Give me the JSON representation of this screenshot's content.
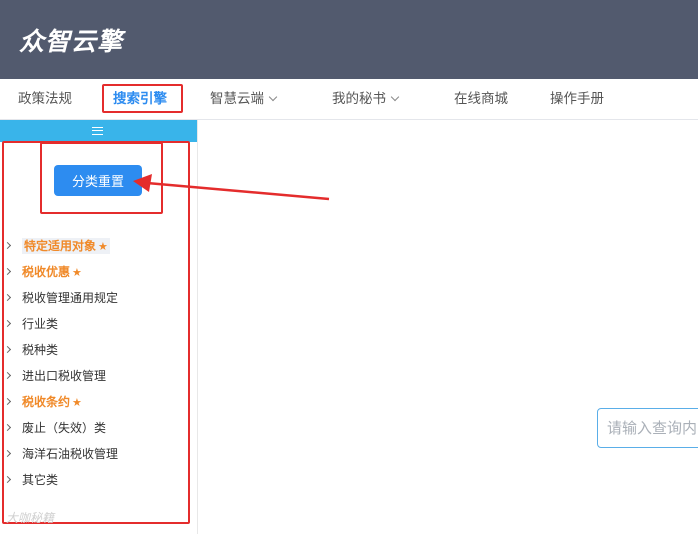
{
  "header": {
    "logo_text": "众智云擎",
    "background": "#525a6e"
  },
  "nav": {
    "items": [
      {
        "label": "政策法规",
        "has_dropdown": false,
        "active": false
      },
      {
        "label": "搜索引擎",
        "has_dropdown": false,
        "active": true
      },
      {
        "label": "智慧云端",
        "has_dropdown": true,
        "active": false
      },
      {
        "label": "我的秘书",
        "has_dropdown": true,
        "active": false
      },
      {
        "label": "在线商城",
        "has_dropdown": false,
        "active": false
      },
      {
        "label": "操作手册",
        "has_dropdown": false,
        "active": false
      }
    ]
  },
  "sidebar": {
    "toggle_icon": "hamburger-icon",
    "toggle_color": "#39b4ea",
    "reset_button_label": "分类重置",
    "tree": [
      {
        "label": "特定适用对象",
        "highlight": true,
        "star": true,
        "selected": true
      },
      {
        "label": "税收优惠",
        "highlight": true,
        "star": true,
        "selected": false
      },
      {
        "label": "税收管理通用规定",
        "highlight": false,
        "star": false,
        "selected": false
      },
      {
        "label": "行业类",
        "highlight": false,
        "star": false,
        "selected": false
      },
      {
        "label": "税种类",
        "highlight": false,
        "star": false,
        "selected": false
      },
      {
        "label": "进出口税收管理",
        "highlight": false,
        "star": false,
        "selected": false
      },
      {
        "label": "税收条约",
        "highlight": true,
        "star": true,
        "selected": false
      },
      {
        "label": "废止（失效）类",
        "highlight": false,
        "star": false,
        "selected": false
      },
      {
        "label": "海洋石油税收管理",
        "highlight": false,
        "star": false,
        "selected": false
      },
      {
        "label": "其它类",
        "highlight": false,
        "star": false,
        "selected": false
      }
    ]
  },
  "main": {
    "search_placeholder": "请输入查询内"
  },
  "colors": {
    "accent": "#2d8cf0",
    "highlight": "#f08a2a",
    "annotation_red": "#e42c2c"
  },
  "watermark": "大咖秘籍"
}
